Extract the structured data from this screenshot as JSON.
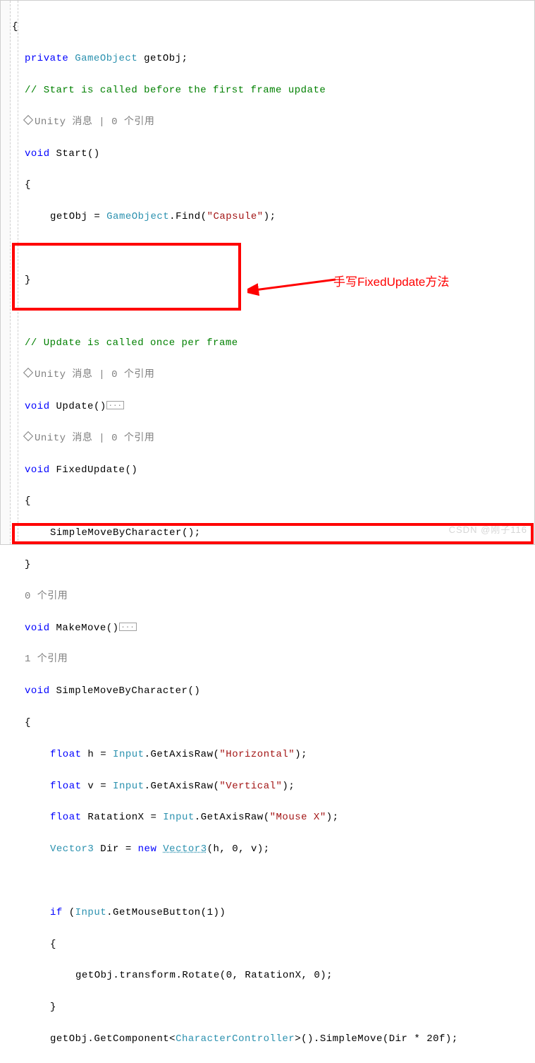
{
  "colors": {
    "keyword": "#0000ff",
    "type": "#2b91af",
    "string": "#a31515",
    "comment": "#008000",
    "gray": "#808080",
    "highlight_box": "#ff0000"
  },
  "annotation": {
    "text": "手写FixedUpdate方法"
  },
  "codelens": {
    "refs_0": "0 个引用",
    "refs_1": "1 个引用",
    "unity_msg_0": "Unity 消息 | 0 个引用"
  },
  "tokens": {
    "private": "private",
    "GameObject": "GameObject",
    "getObj_decl": "getObj",
    "semi": ";",
    "comment_start": "// Start is called before the first frame update",
    "void": "void",
    "Start": "Start",
    "parens": "()",
    "open_brace": "{",
    "close_brace": "}",
    "getObj_assign": "getObj",
    "eq": " = ",
    "Find": "Find",
    "capsule": "\"Capsule\"",
    "comment_update": "// Update is called once per frame",
    "Update": "Update",
    "fold": "...",
    "FixedUpdate": "FixedUpdate",
    "SimpleMoveByCharacter_call": "SimpleMoveByCharacter",
    "MakeMove": "MakeMove",
    "SimpleMoveByCharacter": "SimpleMoveByCharacter",
    "float": "float",
    "h": "h",
    "v": "v",
    "RatationX": "RatationX",
    "Input": "Input",
    "GetAxisRaw": "GetAxisRaw",
    "horizontal": "\"Horizontal\"",
    "vertical": "\"Vertical\"",
    "mousex": "\"Mouse X\"",
    "Vector3": "Vector3",
    "Dir": "Dir",
    "new": "new",
    "zero": "0",
    "if": "if",
    "GetMouseButton": "GetMouseButton",
    "one": "1",
    "transform": "transform",
    "Rotate": "Rotate",
    "GetComponent": "GetComponent",
    "CharacterController": "CharacterController",
    "SimpleMove": "SimpleMove",
    "mult": " * ",
    "twenty": "20f",
    "dot": "."
  },
  "watermark": "CSDN @刚子116"
}
